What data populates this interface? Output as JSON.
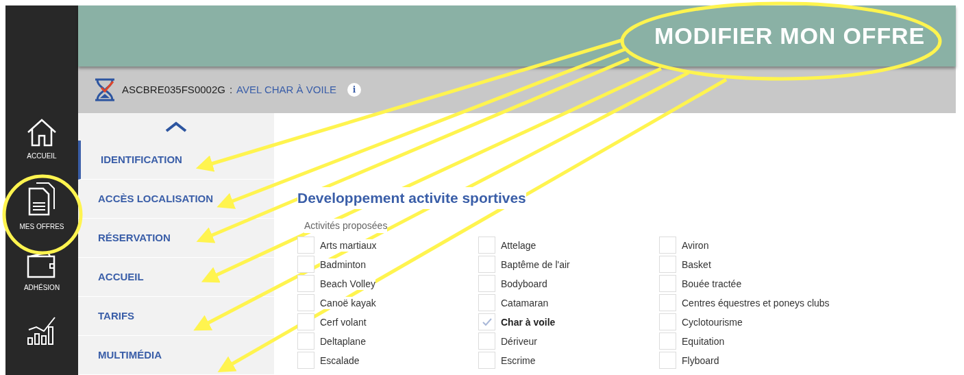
{
  "sidebar": {
    "items": [
      {
        "kind": "home",
        "label": "ACCUEIL"
      },
      {
        "kind": "documents",
        "label": "MES OFFRES"
      },
      {
        "kind": "wallet",
        "label": "ADHÉSION"
      },
      {
        "kind": "chart"
      }
    ]
  },
  "header": {
    "title": "MODIFIER MON OFFRE"
  },
  "offer_bar": {
    "code": "ASCBRE035FS0002G",
    "separator": ":",
    "name": "AVEL CHAR À VOILE",
    "info": "i"
  },
  "sections": [
    {
      "label": "IDENTIFICATION",
      "selected": true
    },
    {
      "label": "ACCÈS LOCALISATION",
      "selected": false
    },
    {
      "label": "RÉSERVATION",
      "selected": false
    },
    {
      "label": "ACCUEIL",
      "selected": false
    },
    {
      "label": "TARIFS",
      "selected": false
    },
    {
      "label": "MULTIMÉDIA",
      "selected": false
    }
  ],
  "form": {
    "title": "Developpement activite sportives",
    "field_label": "Activités proposées",
    "activities": [
      {
        "label": "Arts martiaux",
        "checked": false
      },
      {
        "label": "Attelage",
        "checked": false
      },
      {
        "label": "Aviron",
        "checked": false
      },
      {
        "label": "Badminton",
        "checked": false
      },
      {
        "label": "Baptême de l'air",
        "checked": false
      },
      {
        "label": "Basket",
        "checked": false
      },
      {
        "label": "Beach Volley",
        "checked": false
      },
      {
        "label": "Bodyboard",
        "checked": false
      },
      {
        "label": "Bouée tractée",
        "checked": false
      },
      {
        "label": "Canoë kayak",
        "checked": false
      },
      {
        "label": "Catamaran",
        "checked": false
      },
      {
        "label": "Centres équestres et poneys clubs",
        "checked": false
      },
      {
        "label": "Cerf volant",
        "checked": false
      },
      {
        "label": "Char à voile",
        "checked": true
      },
      {
        "label": "Cyclotourisme",
        "checked": false
      },
      {
        "label": "Deltaplane",
        "checked": false
      },
      {
        "label": "Dériveur",
        "checked": false
      },
      {
        "label": "Equitation",
        "checked": false
      },
      {
        "label": "Escalade",
        "checked": false
      },
      {
        "label": "Escrime",
        "checked": false
      },
      {
        "label": "Flyboard",
        "checked": false
      }
    ]
  }
}
